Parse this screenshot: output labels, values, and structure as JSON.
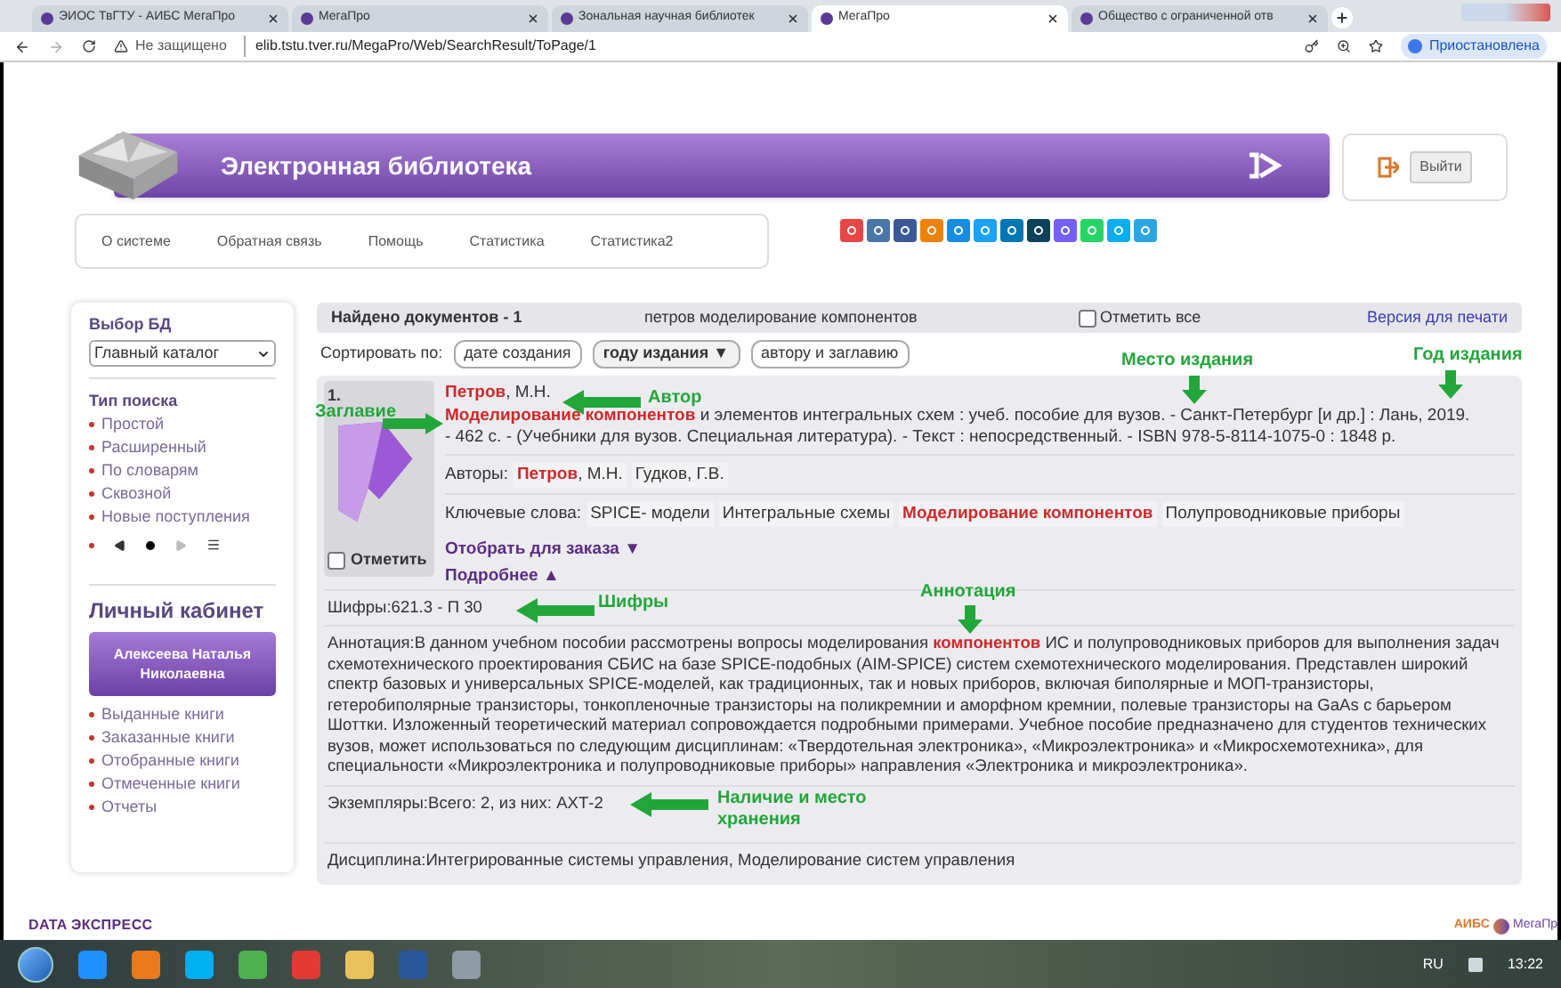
{
  "browser": {
    "tabs": [
      {
        "title": "ЭИОС ТвГТУ - АИБС МегаПро",
        "selected": false
      },
      {
        "title": "МегаПро",
        "selected": false
      },
      {
        "title": "Зональная научная библиотек",
        "selected": false
      },
      {
        "title": "МегаПро",
        "selected": true
      },
      {
        "title": "Общество с ограниченной отв",
        "selected": false
      }
    ],
    "security": "Не защищено",
    "url": "elib.tstu.tver.ru/MegaPro/Web/SearchResult/ToPage/1",
    "profile": "Приостановлена"
  },
  "header": {
    "title": "Электронная библиотека",
    "logout": "Выйти"
  },
  "nav": [
    "О системе",
    "Обратная связь",
    "Помощь",
    "Статистика",
    "Статистика2"
  ],
  "social": [
    {
      "color": "#e64646"
    },
    {
      "color": "#4a76a8"
    },
    {
      "color": "#3b5998"
    },
    {
      "color": "#ee8208"
    },
    {
      "color": "#168de2"
    },
    {
      "color": "#1da1f2"
    },
    {
      "color": "#0077b5"
    },
    {
      "color": "#0d425a"
    },
    {
      "color": "#7360f2"
    },
    {
      "color": "#25d366"
    },
    {
      "color": "#00aff0"
    },
    {
      "color": "#2ca5e0"
    }
  ],
  "sidebar": {
    "db_label": "Выбор БД",
    "db_value": "Главный каталог",
    "search_type_label": "Тип поиска",
    "search_types": [
      "Простой",
      "Расширенный",
      "По словарям",
      "Сквозной",
      "Новые поступления"
    ],
    "cabinet_label": "Личный кабинет",
    "user": "Алексеева Наталья Николаевна",
    "cabinet_links": [
      "Выданные книги",
      "Заказанные книги",
      "Отобранные книги",
      "Отмеченные книги",
      "Отчеты"
    ]
  },
  "results": {
    "found": "Найдено документов - 1",
    "query": "петров моделирование компонентов",
    "mark_all": {
      "label": "Отметить все",
      "checked": false
    },
    "print": "Версия для печати",
    "sort_label": "Сортировать по:",
    "sort_options": [
      {
        "label": "дате создания",
        "selected": false
      },
      {
        "label": "году издания ▼",
        "selected": true
      },
      {
        "label": "автору и заглавию",
        "selected": false
      }
    ],
    "record": {
      "number": "1.",
      "author": "**Петров**, М.Н.",
      "description": "**Моделирование компонентов** и элементов интегральных схем : учеб. пособие для вузов. - Санкт-Петербург [и др.] : Лань, 2019. - 462 с. - (Учебники для вузов. Специальная литература). - Текст : непосредственный. - ISBN 978-5-8114-1075-0 : 1848 р.",
      "authors_label": "Авторы:",
      "authors": [
        "**Петров**, М.Н.",
        "Гудков, Г.В."
      ],
      "keywords_label": "Ключевые слова:",
      "keywords": [
        "SPICE- модели",
        "Интегральные схемы",
        "**Моделирование компонентов**",
        "Полупроводниковые приборы"
      ],
      "order": "Отобрать для заказа ▼",
      "more": "Подробнее ▲",
      "mark": {
        "label": "Отметить",
        "checked": false
      },
      "fields": [
        "Шифры:621.3 - П 30",
        "Аннотация:В данном учебном пособии рассмотрены вопросы моделирования **компонентов** ИС и полупроводниковых приборов для выполнения задач схемотехнического проектирования СБИС на базе SPICE-подобных (AIM-SPICE) систем схемотехнического моделирования. Представлен широкий спектр базовых и универсальных SPICE-моделей, как традиционных, так и новых приборов, включая биполярные и МОП-транзисторы, гетеробиполярные транзисторы, тонкопленочные транзисторы на поликремнии и аморфном кремнии, полевые транзисторы на GaAs с барьером Шоттки. Изложенный теоретический материал сопровождается подробными примерами. Учебное пособие предназначено для студентов технических вузов, может использоваться по следующим дисциплинам: «Твердотельная электроника», «Микроэлектроника» и «Микросхемотехника», для специальности «Микроэлектроника и полупроводниковые приборы» направления «Электроника и микроэлектроника».",
        "Экземпляры:Всего: 2, из них: АХТ-2",
        "Дисциплина:Интегрированные системы управления, Моделирование систем управления"
      ]
    }
  },
  "callouts": [
    {
      "text": "Автор",
      "kind": "left"
    },
    {
      "text": "Заглавие",
      "kind": "right"
    },
    {
      "text": "Место издания",
      "kind": "down"
    },
    {
      "text": "Год издания",
      "kind": "down"
    },
    {
      "text": "Шифры",
      "kind": "left"
    },
    {
      "text": "Аннотация",
      "kind": "down"
    },
    {
      "text": "Наличие и место хранения",
      "kind": "left"
    }
  ],
  "footer": {
    "left_logo": "DATA ЭКСПРЕСС",
    "right_logo": "АИБС",
    "right_logo_name": "МегаПр"
  },
  "taskbar": {
    "language": "RU",
    "time": "13:22"
  }
}
